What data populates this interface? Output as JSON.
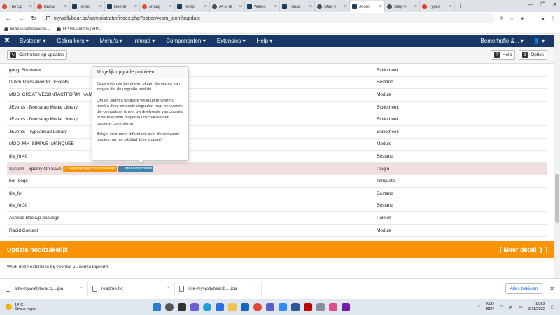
{
  "browser": {
    "tabs": [
      {
        "label": "The Sp",
        "fav": ""
      },
      {
        "label": "Brand",
        "fav": ""
      },
      {
        "label": "Templ",
        "fav": "j"
      },
      {
        "label": "Bemer",
        "fav": "j"
      },
      {
        "label": "chang",
        "fav": ""
      },
      {
        "label": "Templ",
        "fav": "j"
      },
      {
        "label": "J4.x:Te",
        "fav": "g"
      },
      {
        "label": "Welco",
        "fav": "j"
      },
      {
        "label": "Trinsa",
        "fav": "j"
      },
      {
        "label": "Stap-v",
        "fav": "g"
      },
      {
        "label": "Jooml",
        "fav": "j",
        "active": true
      },
      {
        "label": "Stap-v",
        "fav": "g"
      },
      {
        "label": "Types",
        "fav": "t"
      }
    ],
    "url": "mywollybear.be/administrator/index.php?option=com_joomlaupdate",
    "bookmarks": [
      "Broekx schooladmi...",
      "HP Instant Ink | HP..."
    ]
  },
  "joomla": {
    "logo": "✖",
    "menu": [
      "Systeem ▾",
      "Gebruikers ▾",
      "Menu's ▾",
      "Inhoud ▾",
      "Componenten ▾",
      "Extensies ▾",
      "Help ▾"
    ],
    "site": "Bemerhofje &... ▾",
    "user": "👤 ▾"
  },
  "toolbar": {
    "check_label": "Controleer op updates",
    "help_label": "Help",
    "options_label": "Opties"
  },
  "extensions": [
    {
      "name": "googl Shortener",
      "type": "Bibliotheek"
    },
    {
      "name": "Dutch Translation for JEvents",
      "type": "Bestand"
    },
    {
      "name": "MOD_CREATIVECONTACTFORM_NAME",
      "type": "Module"
    },
    {
      "name": "JEvents - Bootstrap Modal Library",
      "type": "Bibliotheek"
    },
    {
      "name": "JEvents - Bootstrap Modal Library",
      "type": "Bibliotheek"
    },
    {
      "name": "JEvents - Typeahead Library",
      "type": "Bibliotheek"
    },
    {
      "name": "MOD_MH_SIMPLE_MARQUEE",
      "type": "Module"
    },
    {
      "name": "file_fof40",
      "type": "Bestand"
    },
    {
      "name": "System - Sparky On Save",
      "type": "Plugin",
      "highlight": true,
      "warn": "⚠ Mogelijk upgrade probleem",
      "info": "❓ Meer informatie"
    },
    {
      "name": "hot_dogs",
      "type": "Template"
    },
    {
      "name": "file_fef",
      "type": "Bestand"
    },
    {
      "name": "file_fof30",
      "type": "Bestand"
    },
    {
      "name": "Akeeba Backup package",
      "type": "Pakket"
    },
    {
      "name": "Rapid Contact",
      "type": "Module"
    }
  ],
  "popover": {
    "title": "Mogelijk upgrade probleem",
    "p1": "Deze extensie bevat een plugin die ervoor kan zorgen dat de upgrade mislukt.",
    "p2": "Om de Joomla upgrade veilig uit te voeren, moet u deze extensie upgraden naar een versie die compatibel is met uw doelversie van Joomla of de relevante plugin(s) uitschakelen en opnieuw controleren.",
    "p3": "Bekijk, voor meer informatie over de relevante plugins, op het tabblad 'Live Update'."
  },
  "update_panel": {
    "title": "Update noodzakelijk",
    "more": "[ Meer detail ❯ ]",
    "note": "Werk deze extensies bij voordat u Joomla bijwerkt"
  },
  "downloads": {
    "items": [
      "site-mywollybear.b....jpa",
      "readme.txt",
      "site-mywollybear.b....jpa"
    ],
    "show_all": "Alles bekijken"
  },
  "taskbar": {
    "temp": "14°C",
    "weather": "Straks regen",
    "lang": "NLD",
    "lang2": "BEP",
    "time": "15:53",
    "date": "3/11/2022"
  },
  "colors": {
    "joomla_nav": "#1a3867",
    "warning": "#f89406",
    "info": "#3a87ad",
    "highlight_row": "#f2dede"
  }
}
